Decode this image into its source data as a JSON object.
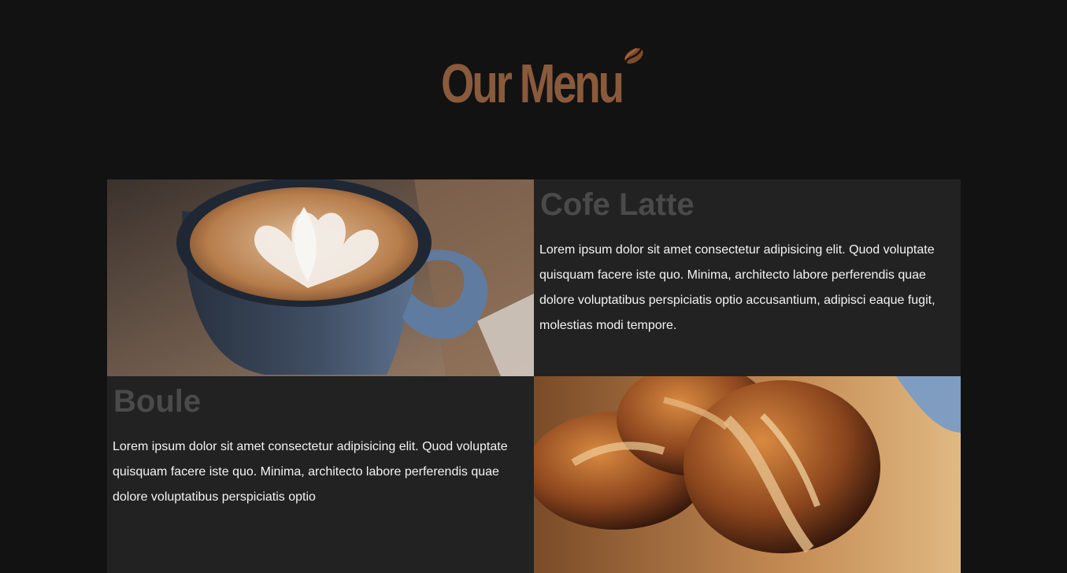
{
  "header": {
    "title": "Our Menu",
    "decoration_icon": "coffee-bean-icon"
  },
  "menu": {
    "items": [
      {
        "name": "Cofe Latte",
        "description": "Lorem ipsum dolor sit amet consectetur adipisicing elit. Quod voluptate quisquam facere iste quo. Minima, architecto labore perferendis quae dolore voluptatibus perspiciatis optio accusantium, adipisci eaque fugit, molestias modi tempore.",
        "image": "coffee-latte-photo"
      },
      {
        "name": "Boule",
        "description": "Lorem ipsum dolor sit amet consectetur adipisicing elit. Quod voluptate quisquam facere iste quo. Minima, architecto labore perferendis quae dolore voluptatibus perspiciatis optio",
        "image": "boule-bread-photo"
      }
    ]
  },
  "colors": {
    "background": "#121212",
    "card_background": "#222222",
    "accent": "#8a5a3c",
    "text": "#f3f3f3",
    "muted_heading": "#4a4a4a"
  }
}
